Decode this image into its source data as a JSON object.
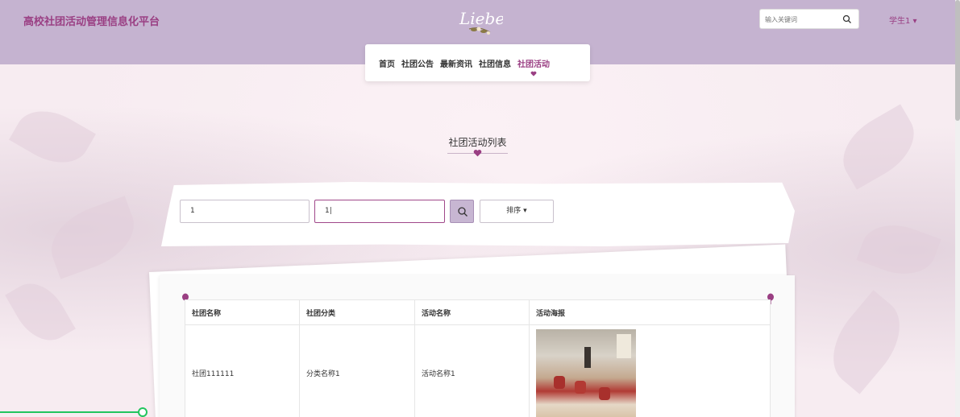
{
  "header": {
    "site_title": "高校社团活动管理信息化平台",
    "search_placeholder": "输入关键词",
    "user_menu": "学生1 ▾"
  },
  "nav": {
    "items": [
      {
        "label": "首页",
        "active": false
      },
      {
        "label": "社团公告",
        "active": false
      },
      {
        "label": "最新资讯",
        "active": false
      },
      {
        "label": "社团信息",
        "active": false
      },
      {
        "label": "社团活动",
        "active": true
      }
    ]
  },
  "section": {
    "title": "社团活动列表"
  },
  "filters": {
    "field1_value": "1",
    "field2_value": "1|",
    "sort_label": "排序 ▾"
  },
  "table": {
    "headers": [
      "社团名称",
      "社团分类",
      "活动名称",
      "活动海报"
    ],
    "rows": [
      {
        "club_name": "社团111111",
        "category": "分类名称1",
        "activity": "活动名称1"
      }
    ]
  },
  "progress": {
    "fraction": 0.148
  },
  "colors": {
    "accent": "#9a3f83",
    "header_bg": "#c5b3d0",
    "progress": "#22c55e"
  }
}
